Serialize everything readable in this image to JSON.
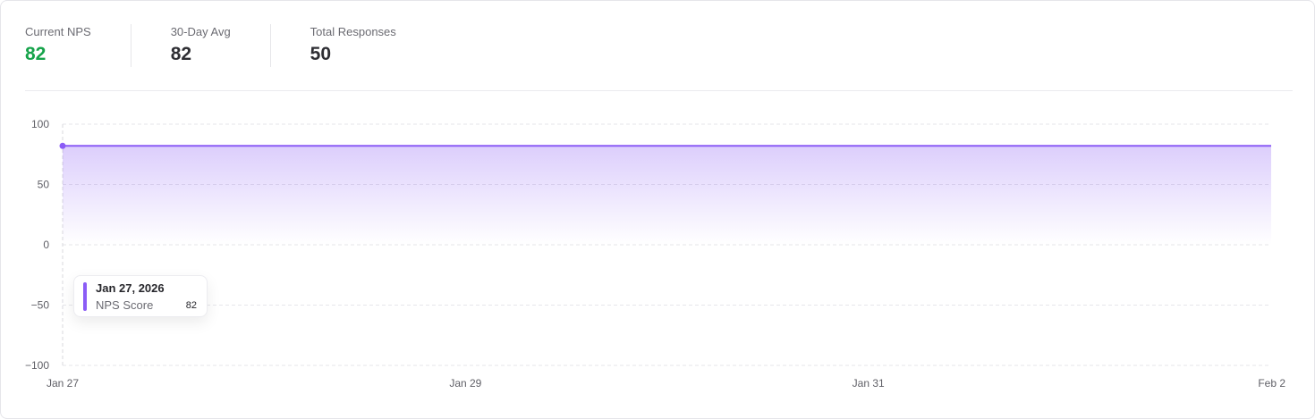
{
  "stats": {
    "current_nps": {
      "label": "Current NPS",
      "value": "82"
    },
    "avg_30_day": {
      "label": "30-Day Avg",
      "value": "82"
    },
    "total_responses": {
      "label": "Total Responses",
      "value": "50"
    }
  },
  "colors": {
    "accent": "#8b5cf6",
    "positive": "#16a34a"
  },
  "tooltip": {
    "date": "Jan 27, 2026",
    "series_label": "NPS Score",
    "value": "82"
  },
  "chart_data": {
    "type": "area",
    "x": [
      "2026-01-27",
      "2026-02-02"
    ],
    "x_tick_labels": [
      "Jan 27",
      "Jan 29",
      "Jan 31",
      "Feb 2"
    ],
    "x_tick_values": [
      "2026-01-27",
      "2026-01-29",
      "2026-01-31",
      "2026-02-02"
    ],
    "series": [
      {
        "name": "NPS Score",
        "values": [
          82,
          82
        ]
      }
    ],
    "ylim": [
      -100,
      100
    ],
    "y_ticks": [
      100,
      50,
      0,
      -50,
      -100
    ],
    "grid": true,
    "xlabel": "",
    "ylabel": ""
  }
}
